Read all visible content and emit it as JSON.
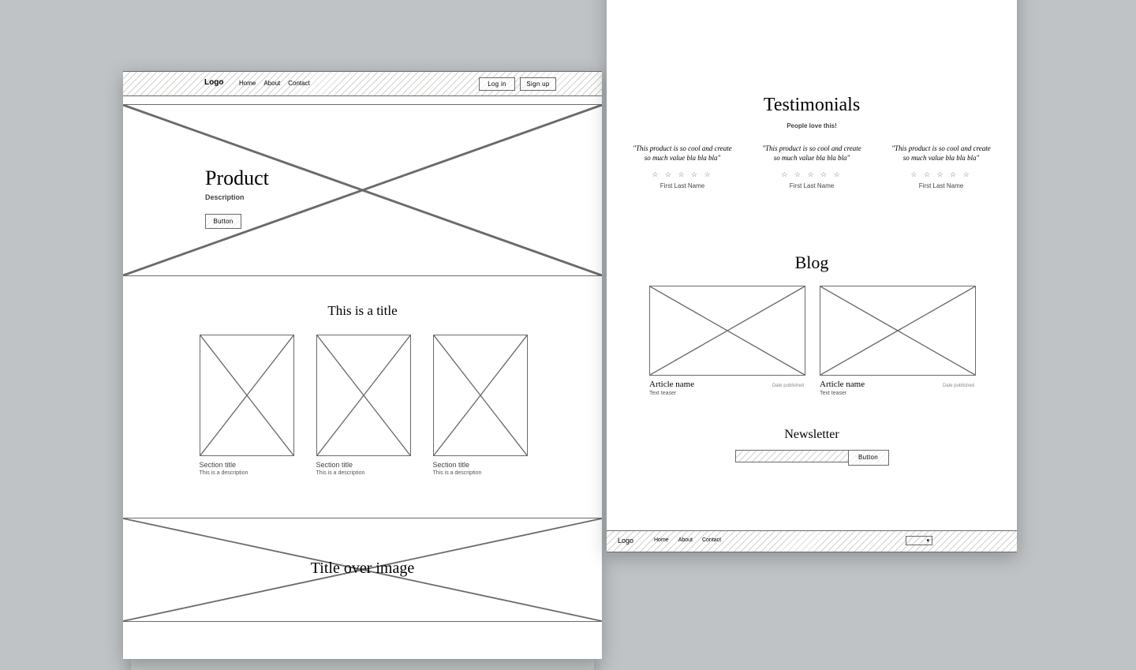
{
  "page1": {
    "nav": {
      "logo": "Logo",
      "links": [
        "Home",
        "About",
        "Contact"
      ],
      "login": "Log in",
      "signup": "Sign up"
    },
    "hero": {
      "title": "Product",
      "desc": "Description",
      "button": "Button"
    },
    "features": {
      "title": "This is a title",
      "cards": [
        {
          "title": "Section title",
          "desc": "This is a description"
        },
        {
          "title": "Section title",
          "desc": "This is a description"
        },
        {
          "title": "Section title",
          "desc": "This is a description"
        }
      ]
    },
    "banner": {
      "title": "Title over image"
    }
  },
  "page2": {
    "testimonials": {
      "title": "Testimonials",
      "subtitle": "People love this!",
      "items": [
        {
          "quote": "\"This product is so cool and create so much value bla bla bla\"",
          "name": "First Last Name"
        },
        {
          "quote": "\"This product is so cool and create so much value bla bla bla\"",
          "name": "First Last Name"
        },
        {
          "quote": "\"This product is so cool and create so much value bla bla bla\"",
          "name": "First Last Name"
        }
      ]
    },
    "blog": {
      "title": "Blog",
      "posts": [
        {
          "name": "Article name",
          "teaser": "Text teaser",
          "date": "Date published"
        },
        {
          "name": "Article name",
          "teaser": "Text teaser",
          "date": "Date published"
        }
      ]
    },
    "newsletter": {
      "title": "Newsletter",
      "button": "Button"
    },
    "footer": {
      "logo": "Logo",
      "links": [
        "Home",
        "About",
        "Contact"
      ]
    }
  }
}
